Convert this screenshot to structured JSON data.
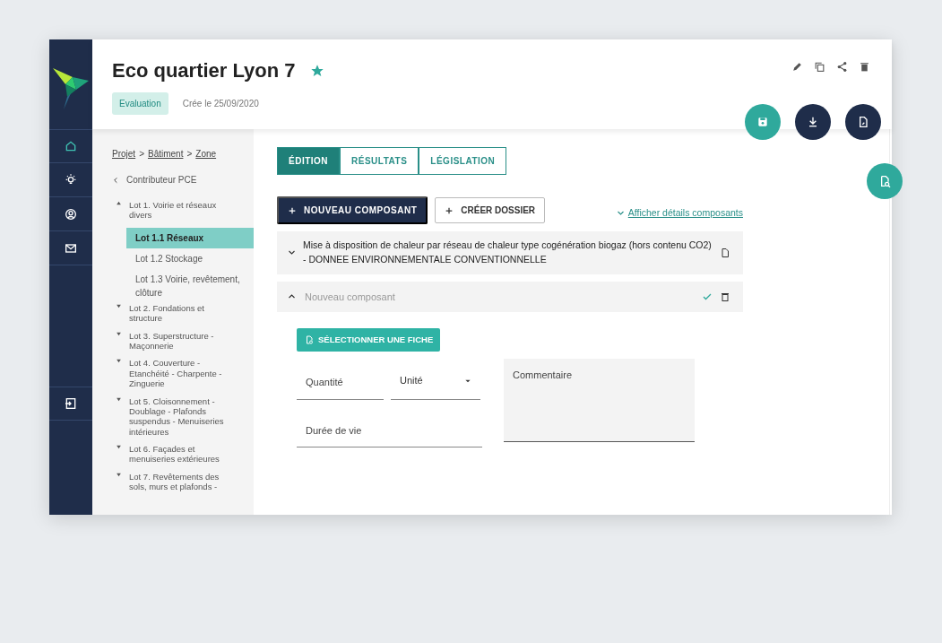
{
  "header": {
    "title": "Eco quartier Lyon 7",
    "favorite": true,
    "status_badge": "Evaluation",
    "created": "Crée le 25/09/2020"
  },
  "breadcrumb": {
    "separator": ">",
    "items": [
      "Projet",
      "Bâtiment",
      "Zone"
    ]
  },
  "back_link": "Contributeur PCE",
  "tree": [
    {
      "label": "Lot 1. Voirie et réseaux divers",
      "expanded": true,
      "children": [
        {
          "label": "Lot 1.1 Réseaux",
          "selected": true
        },
        {
          "label": "Lot 1.2 Stockage",
          "selected": false
        },
        {
          "label": "Lot 1.3 Voirie, revêtement, clôture",
          "selected": false
        }
      ]
    },
    {
      "label": "Lot 2. Fondations et structure",
      "expanded": false
    },
    {
      "label": "Lot 3. Superstructure - Maçonnerie",
      "expanded": false
    },
    {
      "label": "Lot 4. Couverture - Etanchéité - Charpente - Zinguerie",
      "expanded": false
    },
    {
      "label": "Lot 5. Cloisonnement - Doublage - Plafonds suspendus - Menuiseries intérieures",
      "expanded": false
    },
    {
      "label": "Lot 6. Façades et menuiseries extérieures",
      "expanded": false
    },
    {
      "label": "Lot 7. Revêtements des sols, murs et plafonds -",
      "expanded": false
    }
  ],
  "tabs": [
    {
      "label": "ÉDITION",
      "selected": true
    },
    {
      "label": "RÉSULTATS",
      "selected": false
    },
    {
      "label": "LÉGISLATION",
      "selected": false
    }
  ],
  "actions": {
    "new_component": "NOUVEAU COMPOSANT",
    "create_folder": "CRÉER DOSSIER",
    "details_link": "Afficher détails composants"
  },
  "components": [
    {
      "kind": "existing",
      "expanded": false,
      "label": "Mise à disposition de chaleur par réseau de chaleur type cogénération biogaz (hors contenu CO2) - DONNEE ENVIRONNEMENTALE CONVENTIONNELLE"
    },
    {
      "kind": "new",
      "expanded": true,
      "placeholder": "Nouveau composant"
    }
  ],
  "form": {
    "select_button": "SÉLECTIONNER UNE FICHE",
    "quantity": {
      "placeholder": "Quantité"
    },
    "unit": {
      "placeholder": "Unité"
    },
    "lifetime": {
      "placeholder": "Durée de vie"
    },
    "comment": {
      "placeholder": "Commentaire"
    }
  }
}
